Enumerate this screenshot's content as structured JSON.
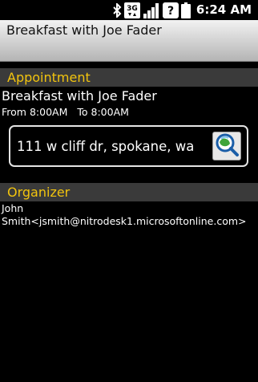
{
  "status_bar": {
    "time": "6:24 AM",
    "icons": [
      "bluetooth-icon",
      "3g-network-icon",
      "signal-bars-icon",
      "question-icon",
      "battery-icon"
    ],
    "network_label": "3G",
    "question_label": "?"
  },
  "title_bar": {
    "title": "Breakfast with Joe Fader"
  },
  "appointment": {
    "header": "Appointment",
    "subject": "Breakfast with Joe Fader",
    "from_label": "From",
    "from_time": "8:00AM",
    "to_label": "To",
    "to_time": "8:00AM",
    "location": "111 w cliff dr, spokane, wa",
    "location_button_icon": "map-search-icon"
  },
  "organizer": {
    "header": "Organizer",
    "name": "John",
    "detail": "Smith<jsmith@nitrodesk1.microsoftonline.com>"
  },
  "colors": {
    "accent": "#f2c40e",
    "background": "#000000",
    "section_header_bg": "#3a3a3a"
  }
}
